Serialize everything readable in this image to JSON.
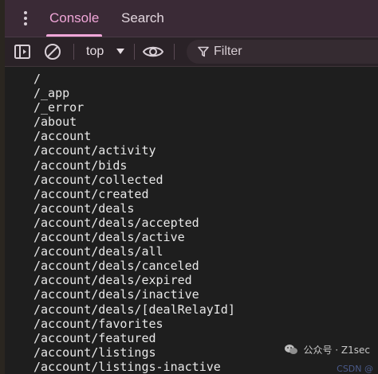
{
  "tabs": [
    {
      "label": "Console",
      "active": true
    },
    {
      "label": "Search",
      "active": false
    }
  ],
  "toolbar": {
    "context": "top",
    "filter_placeholder": "Filter"
  },
  "log_lines": [
    "/",
    "/_app",
    "/_error",
    "/about",
    "/account",
    "/account/activity",
    "/account/bids",
    "/account/collected",
    "/account/created",
    "/account/deals",
    "/account/deals/accepted",
    "/account/deals/active",
    "/account/deals/all",
    "/account/deals/canceled",
    "/account/deals/expired",
    "/account/deals/inactive",
    "/account/deals/[dealRelayId]",
    "/account/favorites",
    "/account/featured",
    "/account/listings",
    "/account/listings-inactive"
  ],
  "watermark": {
    "text": "公众号 · Z1sec",
    "subtext": "CSDN @"
  },
  "colors": {
    "accent": "#f0a6d8",
    "tabbar_bg": "#3a2a36",
    "console_bg": "#1e1e1e"
  }
}
